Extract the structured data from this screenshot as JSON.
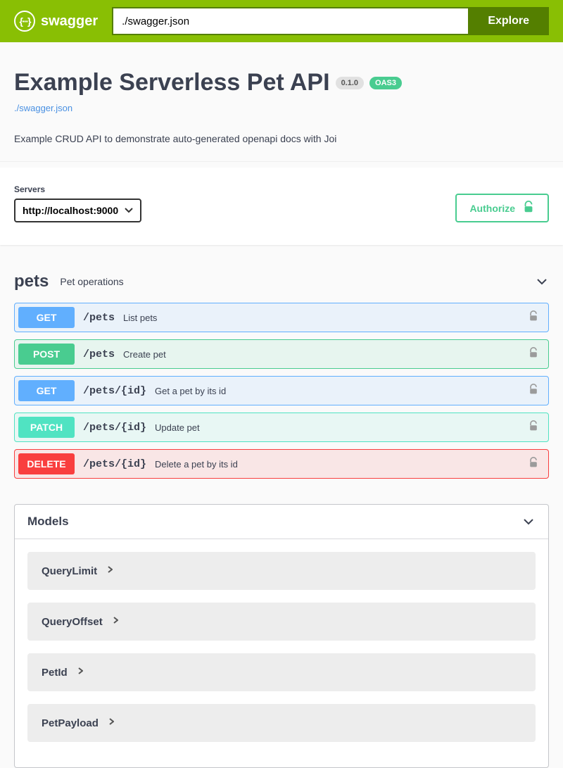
{
  "topbar": {
    "brand": "swagger",
    "url_value": "./swagger.json",
    "explore_label": "Explore"
  },
  "info": {
    "title": "Example Serverless Pet API",
    "version": "0.1.0",
    "oas_badge": "OAS3",
    "spec_link": "./swagger.json",
    "description": "Example CRUD API to demonstrate auto-generated openapi docs with Joi"
  },
  "servers": {
    "label": "Servers",
    "selected": "http://localhost:9000"
  },
  "authorize_label": "Authorize",
  "tag": {
    "name": "pets",
    "description": "Pet operations"
  },
  "operations": [
    {
      "method": "GET",
      "path": "/pets",
      "summary": "List pets"
    },
    {
      "method": "POST",
      "path": "/pets",
      "summary": "Create pet"
    },
    {
      "method": "GET",
      "path": "/pets/{id}",
      "summary": "Get a pet by its id"
    },
    {
      "method": "PATCH",
      "path": "/pets/{id}",
      "summary": "Update pet"
    },
    {
      "method": "DELETE",
      "path": "/pets/{id}",
      "summary": "Delete a pet by its id"
    }
  ],
  "models": {
    "title": "Models",
    "items": [
      {
        "name": "QueryLimit"
      },
      {
        "name": "QueryOffset"
      },
      {
        "name": "PetId"
      },
      {
        "name": "PetPayload"
      }
    ]
  }
}
